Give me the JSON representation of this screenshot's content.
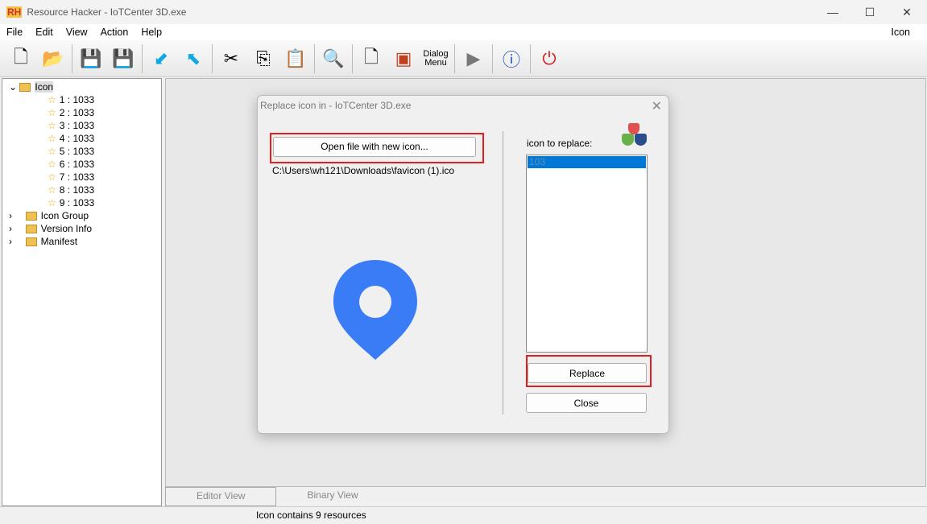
{
  "window": {
    "logo": "RH",
    "title": "Resource Hacker - IoTCenter 3D.exe",
    "minimize": "—",
    "maximize": "☐",
    "close": "✕"
  },
  "menu": {
    "items": [
      "File",
      "Edit",
      "View",
      "Action",
      "Help"
    ],
    "right": "Icon"
  },
  "toolbar": {
    "dialog_menu_line1": "Dialog",
    "dialog_menu_line2": "Menu"
  },
  "tree": {
    "root": "Icon",
    "children": [
      "1 : 1033",
      "2 : 1033",
      "3 : 1033",
      "4 : 1033",
      "5 : 1033",
      "6 : 1033",
      "7 : 1033",
      "8 : 1033",
      "9 : 1033"
    ],
    "others": [
      "Icon Group",
      "Version Info",
      "Manifest"
    ]
  },
  "tabs": [
    "Editor View",
    "Binary View"
  ],
  "status": "Icon contains 9 resources",
  "dialog": {
    "title": "Replace icon in - IoTCenter 3D.exe",
    "open_button": "Open file with new icon...",
    "file_path": "C:\\Users\\wh121\\Downloads\\favicon (1).ico",
    "icon_to_replace_label": "icon to replace:",
    "list_items": [
      "103"
    ],
    "replace_button": "Replace",
    "close_button": "Close",
    "close_icon": "✕"
  },
  "colors": {
    "highlight": "#e02020",
    "selection": "#0078d7",
    "pin": "#3a7cf5"
  }
}
